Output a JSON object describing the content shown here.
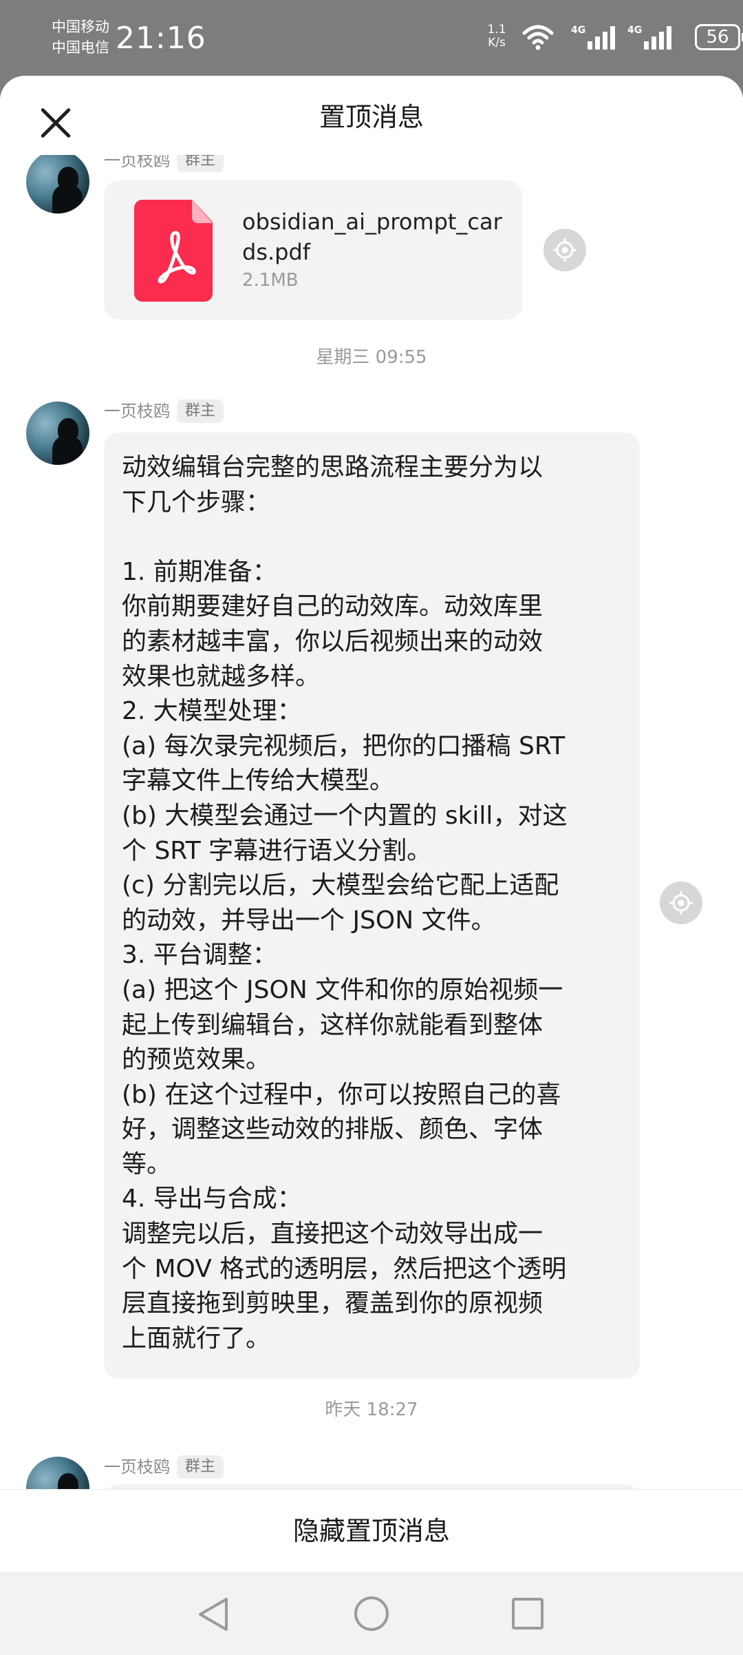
{
  "status_bar": {
    "carrier_1": "中国移动",
    "carrier_2": "中国电信",
    "time": "21:16",
    "net_speed_value": "1.1",
    "net_speed_unit": "K/s",
    "signal_1_label": "4G",
    "signal_2_label": "4G",
    "battery": "56",
    "icons": [
      "wifi-icon",
      "signal-4g-icon",
      "signal-4g-icon",
      "battery-icon"
    ]
  },
  "sheet": {
    "title": "置顶消息",
    "close_icon": "close-icon"
  },
  "messages": [
    {
      "sender": "一页枝鸥",
      "role": "群主",
      "file": {
        "name": "obsidian_ai_prompt_cards.pdf",
        "size": "2.1MB",
        "type_icon": "pdf-file-icon"
      }
    },
    {
      "timestamp": "星期三 09:55",
      "sender": "一页枝鸥",
      "role": "群主",
      "text": "动效编辑台完整的思路流程主要分为以\n下几个步骤：\n\n1. 前期准备：\n你前期要建好自己的动效库。动效库里\n的素材越丰富，你以后视频出来的动效\n效果也就越多样。\n2. 大模型处理：\n(a) 每次录完视频后，把你的口播稿 SRT\n字幕文件上传给大模型。\n(b) 大模型会通过一个内置的 skill，对这\n个 SRT 字幕进行语义分割。\n(c) 分割完以后，大模型会给它配上适配\n的动效，并导出一个 JSON 文件。\n3. 平台调整：\n(a) 把这个 JSON 文件和你的原始视频一\n起上传到编辑台，这样你就能看到整体\n的预览效果。\n(b) 在这个过程中，你可以按照自己的喜\n好，调整这些动效的排版、颜色、字体\n等。\n4. 导出与合成：\n调整完以后，直接把这个动效导出成一\n个 MOV 格式的透明层，然后把这个透明\n层直接拖到剪映里，覆盖到你的原视频\n上面就行了。"
    },
    {
      "timestamp": "昨天 18:27",
      "sender": "一页枝鸥",
      "role": "群主"
    }
  ],
  "bottom_action": {
    "label": "隐藏置顶消息"
  },
  "nav_bar": {
    "icons": [
      "back-icon",
      "home-icon",
      "recents-icon"
    ]
  },
  "colors": {
    "accent_pdf": "#fb2c4d",
    "bubble_bg": "#f3f3f3",
    "status_bar_bg": "#7d7d7d"
  }
}
